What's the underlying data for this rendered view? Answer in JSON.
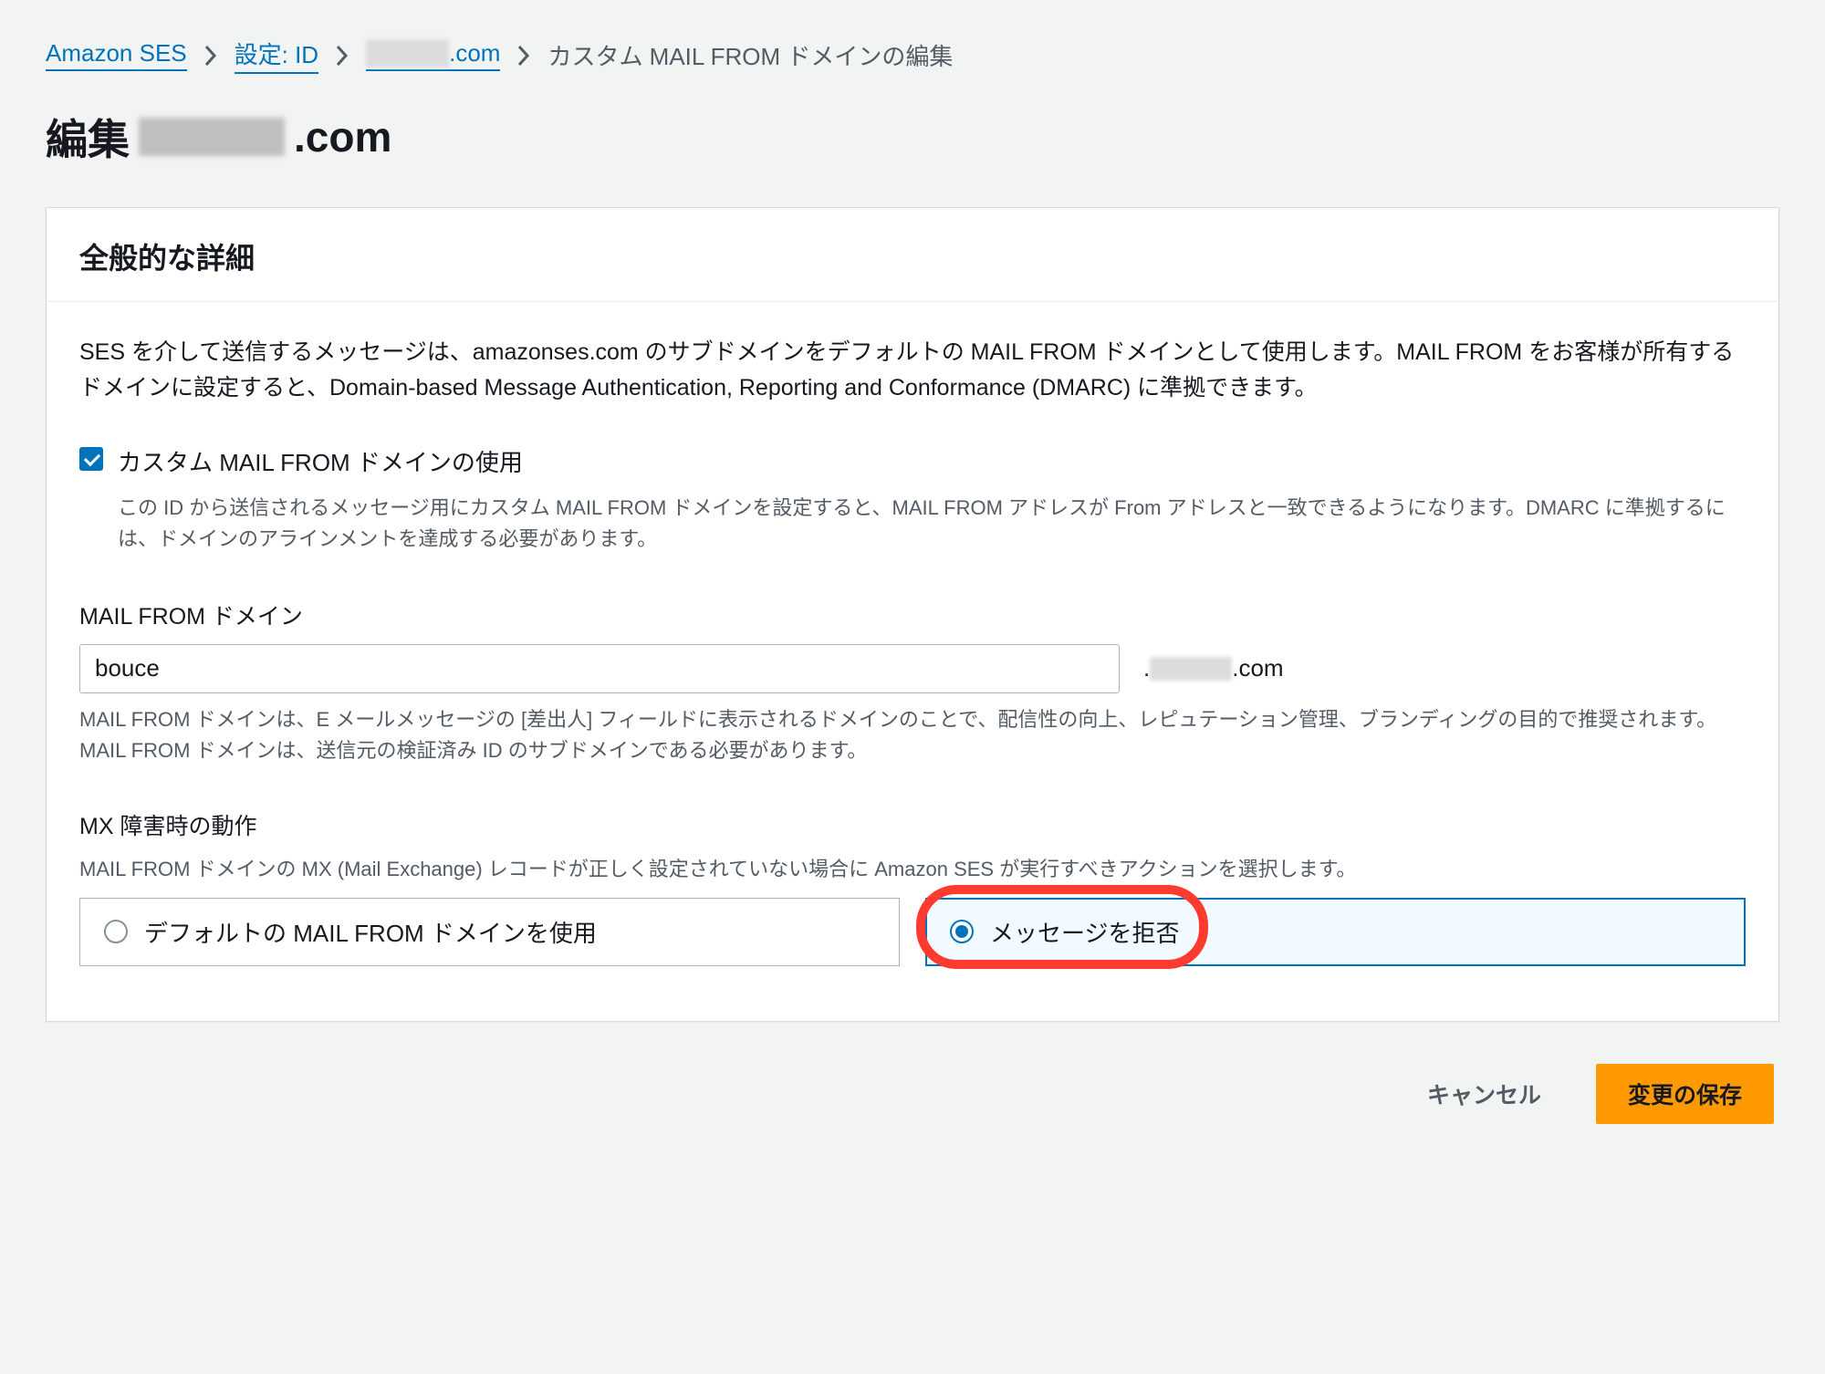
{
  "breadcrumbs": {
    "root": "Amazon SES",
    "config": "設定: ID",
    "domain_suffix": ".com",
    "current": "カスタム MAIL FROM ドメインの編集"
  },
  "page_title_prefix": "編集",
  "page_title_suffix": ".com",
  "panel": {
    "header": "全般的な詳細",
    "description": "SES を介して送信するメッセージは、amazonses.com のサブドメインをデフォルトの MAIL FROM ドメインとして使用します。MAIL FROM をお客様が所有するドメインに設定すると、Domain-based Message Authentication, Reporting and Conformance (DMARC) に準拠できます。",
    "checkbox": {
      "checked": true,
      "label": "カスタム MAIL FROM ドメインの使用",
      "help": "この ID から送信されるメッセージ用にカスタム MAIL FROM ドメインを設定すると、MAIL FROM アドレスが From アドレスと一致できるようになります。DMARC に準拠するには、ドメインのアラインメントを達成する必要があります。"
    },
    "mailfrom": {
      "label": "MAIL FROM ドメイン",
      "value": "bouce",
      "suffix": ".com",
      "help": "MAIL FROM ドメインは、E メールメッセージの [差出人] フィールドに表示されるドメインのことで、配信性の向上、レピュテーション管理、ブランディングの目的で推奨されます。MAIL FROM ドメインは、送信元の検証済み ID のサブドメインである必要があります。"
    },
    "mx": {
      "label": "MX 障害時の動作",
      "help": "MAIL FROM ドメインの MX (Mail Exchange) レコードが正しく設定されていない場合に Amazon SES が実行すべきアクションを選択します。",
      "options": {
        "default": "デフォルトの MAIL FROM ドメインを使用",
        "reject": "メッセージを拒否"
      },
      "selected": "reject"
    }
  },
  "footer": {
    "cancel": "キャンセル",
    "save": "変更の保存"
  }
}
